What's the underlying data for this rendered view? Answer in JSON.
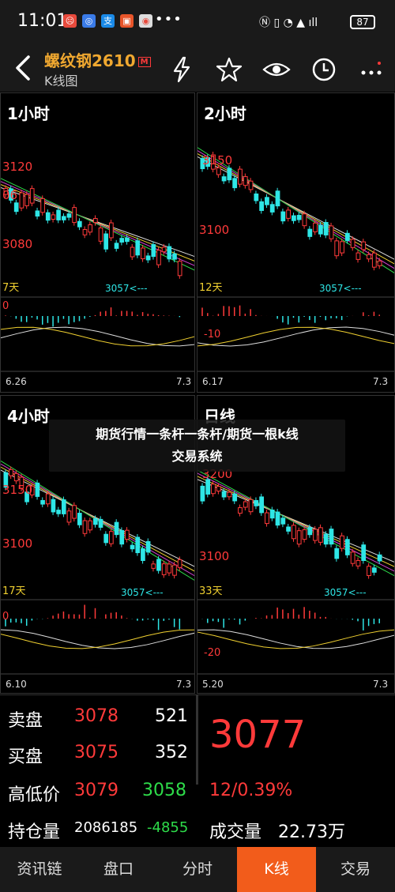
{
  "status_bar": {
    "time": "11:01",
    "battery": "87"
  },
  "header": {
    "title": "螺纹钢2610",
    "title_tag": "M",
    "subtitle": "K线图"
  },
  "panels": [
    {
      "title": "1小时",
      "price_top": "3120",
      "price_mid": "06",
      "price_low": "3080",
      "count": "7天",
      "marker": "3057<---",
      "vol_label": "0",
      "date_start": "6.26",
      "date_end": "7.3"
    },
    {
      "title": "2小时",
      "price_top": "3150",
      "price_mid": "3100",
      "count": "12天",
      "marker": "3057<---",
      "vol_label": "-10",
      "date_start": "6.17",
      "date_end": "7.3"
    },
    {
      "title": "4小时",
      "price_top": "3150",
      "price_mid": "3100",
      "count": "17天",
      "marker": "3057<---",
      "vol_label": "0",
      "date_start": "6.10",
      "date_end": "7.3"
    },
    {
      "title": "日线",
      "price_top": "3200",
      "price_mid": "3100",
      "count": "33天",
      "marker": "3057<---",
      "vol_label": "-20",
      "date_start": "5.20",
      "date_end": "7.3"
    }
  ],
  "banner": {
    "line1": "期货行情一条杆一条杆/期货一根k线",
    "line2": "交易系统"
  },
  "quote": {
    "sell_label": "卖盘",
    "sell_price": "3078",
    "sell_qty": "521",
    "buy_label": "买盘",
    "buy_price": "3075",
    "buy_qty": "352",
    "hilo_label": "高低价",
    "high": "3079",
    "low": "3058",
    "oi_label": "持仓量",
    "oi": "2086185",
    "oi_change": "-4855",
    "last_price": "3077",
    "change": "12/0.39%",
    "volume_label": "成交量",
    "volume": "22.73万"
  },
  "nav": [
    "资讯链",
    "盘口",
    "分时",
    "K线",
    "交易"
  ],
  "colors": {
    "up": "#ff3a3a",
    "down": "#2ee6e6",
    "accent": "#f25c1b",
    "title": "#f0a830",
    "green": "#2edc4a"
  }
}
